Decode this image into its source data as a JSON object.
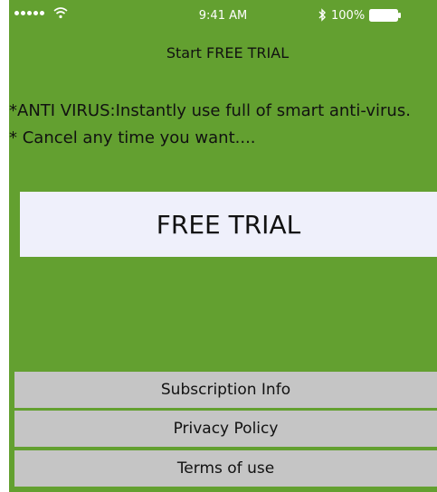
{
  "status_bar": {
    "time": "9:41 AM",
    "battery": "100%"
  },
  "header": {
    "title": "Start FREE TRIAL"
  },
  "info": {
    "line1": "*ANTI VIRUS:Instantly use full of smart anti-virus.",
    "line2": "* Cancel any time you want...."
  },
  "cta": {
    "label": "FREE TRIAL"
  },
  "footer": {
    "subscription_label": "Subscription Info",
    "privacy_label": "Privacy Policy",
    "terms_label": "Terms of use"
  },
  "colors": {
    "background": "#63a030",
    "button": "#eff0fb",
    "footer_button": "#c5c5c5"
  },
  "icons": [
    "signal-icon",
    "wifi-icon",
    "bluetooth-icon",
    "battery-icon"
  ]
}
